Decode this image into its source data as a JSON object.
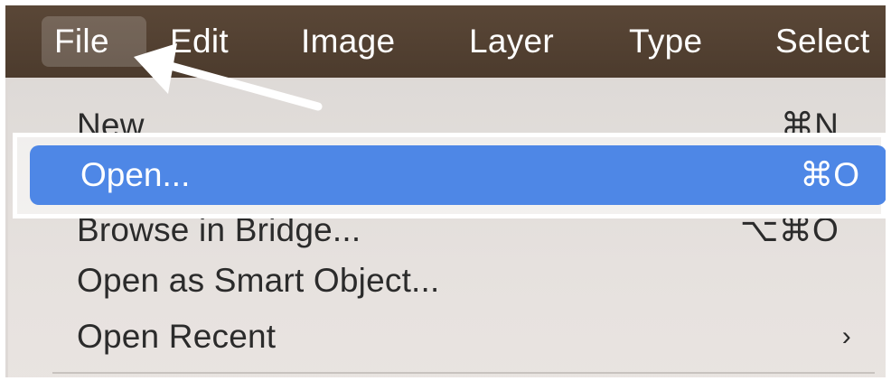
{
  "menubar": {
    "items": [
      {
        "label": "File"
      },
      {
        "label": "Edit"
      },
      {
        "label": "Image"
      },
      {
        "label": "Layer"
      },
      {
        "label": "Type"
      },
      {
        "label": "Select"
      }
    ]
  },
  "file_menu": {
    "items": [
      {
        "label": "New",
        "shortcut": "⌘N"
      },
      {
        "label": "Open...",
        "shortcut": "⌘O",
        "highlighted": true
      },
      {
        "label": "Browse in Bridge...",
        "shortcut": "⌥⌘O"
      },
      {
        "label": "Open as Smart Object...",
        "shortcut": ""
      },
      {
        "label": "Open Recent",
        "shortcut": "",
        "submenu_indicator": "›"
      }
    ]
  },
  "annotation": {
    "arrow_target": "File menu",
    "arrow_color": "#ffffff",
    "highlight_color": "#4e87e6"
  }
}
